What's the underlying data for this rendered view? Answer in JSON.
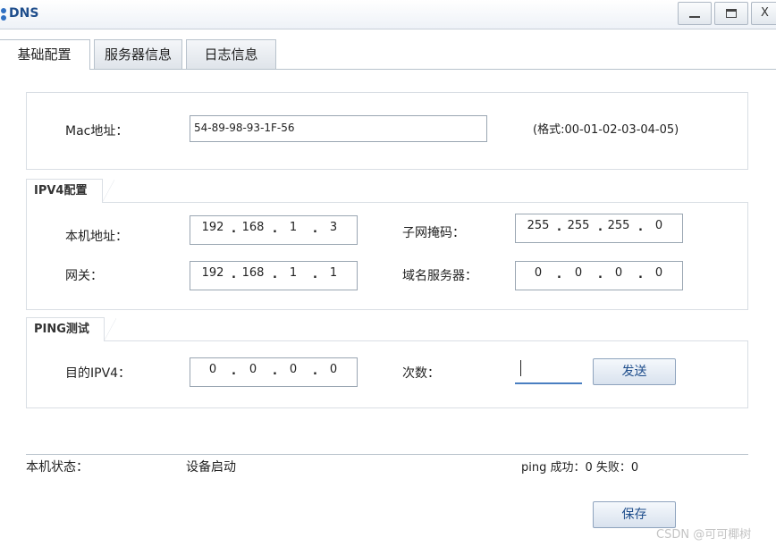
{
  "window": {
    "title": "DNS",
    "close_glyph": "X"
  },
  "tabs": [
    {
      "label": "基础配置"
    },
    {
      "label": "服务器信息"
    },
    {
      "label": "日志信息"
    }
  ],
  "mac": {
    "label": "Mac地址：",
    "value": "54-89-98-93-1F-56",
    "format_hint": "(格式:00-01-02-03-04-05)"
  },
  "ipv4": {
    "group_label": "IPV4配置",
    "local_ip_label": "本机地址：",
    "local_ip": [
      "192",
      "168",
      "1",
      "3"
    ],
    "subnet_label": "子网掩码：",
    "subnet": [
      "255",
      "255",
      "255",
      "0"
    ],
    "gateway_label": "网关：",
    "gateway": [
      "192",
      "168",
      "1",
      "1"
    ],
    "dns_label": "域名服务器：",
    "dns": [
      "0",
      "0",
      "0",
      "0"
    ]
  },
  "ping": {
    "group_label": "PING测试",
    "target_label": "目的IPV4：",
    "target": [
      "0",
      "0",
      "0",
      "0"
    ],
    "count_label": "次数：",
    "count_value": "",
    "send_label": "发送"
  },
  "status": {
    "label": "本机状态：",
    "value": "设备启动",
    "ping_result": "ping 成功：0 失败：0"
  },
  "actions": {
    "save_label": "保存"
  },
  "watermark": "CSDN @可可椰树",
  "colors": {
    "accent": "#1f4e8c",
    "focus_underline": "#4a7fc1"
  }
}
